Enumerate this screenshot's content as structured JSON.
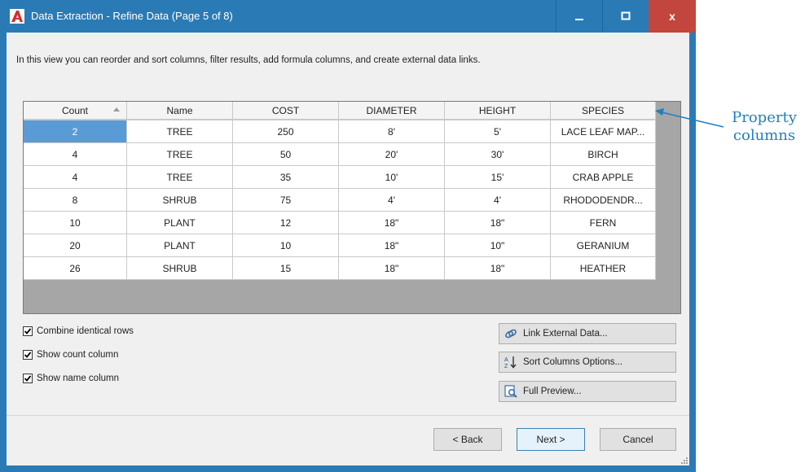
{
  "window": {
    "title": "Data Extraction - Refine Data (Page 5 of 8)",
    "close_glyph": "x"
  },
  "intro_text": "In this view you can reorder and sort columns, filter results, add formula columns, and create external data links.",
  "grid": {
    "columns": [
      "Count",
      "Name",
      "COST",
      "DIAMETER",
      "HEIGHT",
      "SPECIES"
    ],
    "sorted_column": "Count",
    "rows": [
      [
        "2",
        "TREE",
        "250",
        "8'",
        "5'",
        "LACE LEAF MAP..."
      ],
      [
        "4",
        "TREE",
        "50",
        "20'",
        "30'",
        "BIRCH"
      ],
      [
        "4",
        "TREE",
        "35",
        "10'",
        "15'",
        "CRAB APPLE"
      ],
      [
        "8",
        "SHRUB",
        "75",
        "4'",
        "4'",
        "RHODODENDR..."
      ],
      [
        "10",
        "PLANT",
        "12",
        "18\"",
        "18\"",
        "FERN"
      ],
      [
        "20",
        "PLANT",
        "10",
        "18\"",
        "10\"",
        "GERANIUM"
      ],
      [
        "26",
        "SHRUB",
        "15",
        "18\"",
        "18\"",
        "HEATHER"
      ]
    ]
  },
  "options": {
    "combine_rows": "Combine identical rows",
    "show_count": "Show count column",
    "show_name": "Show name column"
  },
  "side_buttons": {
    "link_external": "Link External Data...",
    "sort_options": "Sort Columns Options...",
    "full_preview": "Full Preview..."
  },
  "nav": {
    "back": "< Back",
    "next": "Next >",
    "cancel": "Cancel"
  },
  "callout": {
    "line1": "Property",
    "line2": "columns"
  },
  "colors": {
    "title_bar": "#2a7bb5",
    "close_button": "#c2463d",
    "selected_cell": "#5b9bd5",
    "callout": "#1f7fbf"
  }
}
